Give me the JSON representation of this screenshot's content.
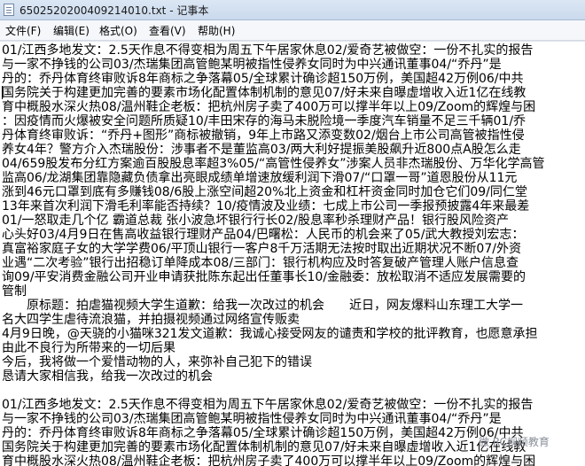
{
  "window": {
    "title": "6502520200409214010.txt - 记事本"
  },
  "menu": {
    "items": [
      "文件(F)",
      "编辑(E)",
      "格式(O)",
      "查看(V)",
      "帮助(H)"
    ]
  },
  "editor": {
    "lines": [
      "01/江西多地发文：2.5天作息不得变相为周五下午居家休息02/爱奇艺被做空：一份不扎实的报告",
      "与一家不挣钱的公司03/杰瑞集团高管鲍某明被指性侵养女同时为中兴通讯董事04/“乔丹”是",
      "丹的：乔丹体育终审败诉8年商标之争落幕05/全球累计确诊超150万例，美国超42万例06/中共",
      "国务院关于构建更加完善的要素市场化配置体制机制的意见07/好未来自曝虚增收入近1亿在线教",
      "育中概股水深火热08/温州鞋企老板：把杭州房子卖了400万可以撑半年以上09/Zoom的辉煌与困",
      "：因疫情而火爆被安全问题所质疑10/丰田宋存的海马未脱险境一季度汽车销量不足三千辆01/乔",
      "丹体育终审败诉：“乔丹+图形”商标被撤销，9年上市路又添变数02/烟台上市公司高管被指性侵",
      "养女4年？警方介入杰瑞股份：涉事者不是董监高03/两大利好提振美股飙升近800点A股怎么走",
      "04/659股发布分红方案逾百股股息率超3%05/“高管性侵养女”涉案人员非杰瑞股份、万华化学高管",
      "监高06/龙湖集团靠隐藏负债拿出亮眼成绩单增速放缓利润下滑07/“口罩一哥”道恩股份从11元",
      "涨到46元口罩到底有多赚钱08/6股上涨空间超20%北上资金和杠杆资金同时加仓它们09/同仁堂",
      "13年来首次利润下滑毛利率能否持续？10/疫情波及业绩：七成上市公司一季报预披露4年来最差",
      "01/一怒取走几个亿 霸道总裁 张小波急坏银行行长02/股息率秒杀理财产品！银行股风险资产",
      "心头好03/4月9日在售高收益银行理财产品04/巴曙松：人民币的机会来了05/武大教授刘宏志：",
      "真富裕家庭子女的大学学费06/平顶山银行一客户8千万活期无法按时取出近期状况不断07/外资",
      "业遇“二次考验”银行出招稳订单降成本08/三部门：银行机构应及时答复破产管理人账户信息查",
      "询09/平安消费金融公司开业申请获批陈东起出任董事长10/金融委：放松取消不适应发展需要的",
      "管制",
      "　　原标题：拍虐猫视频大学生道歉：给我一次改过的机会　　近日，网友爆料山东理工大学一",
      "名大四学生虐待流浪猫，并拍摄视频通过网络宣传贩卖",
      "4月9日晚，@天骁的小猫咪321发文道歉：我诚心接受网友的谴责和学校的批评教育，也愿意承担",
      "由此不良行为所带来的一切后果",
      "今后，我将做一个爱惜动物的人，来弥补自己犯下的错误",
      "恳请大家相信我，给我一次改过的机会",
      "",
      "01/江西多地发文：2.5天作息不得变相为周五下午居家休息02/爱奇艺被做空：一份不扎实的报告",
      "与一家不挣钱的公司03/杰瑞集团高管鲍某明被指性侵养女同时为中兴通讯董事04/“乔丹”是",
      "丹的：乔丹体育终审败诉8年商标之争落幕05/全球累计确诊超150万例，美国超42万例06/中共",
      "国务院关于构建更加完善的要素市场化配置体制机制的意见07/好未来自曝虚增收入近1亿在线教",
      "育中概股水深火热08/温州鞋企老板：把杭州房子卖了400万可以撑半年以上09/Zoom的辉煌与困"
    ]
  },
  "watermark": {
    "text": "微 RC视频教育"
  }
}
